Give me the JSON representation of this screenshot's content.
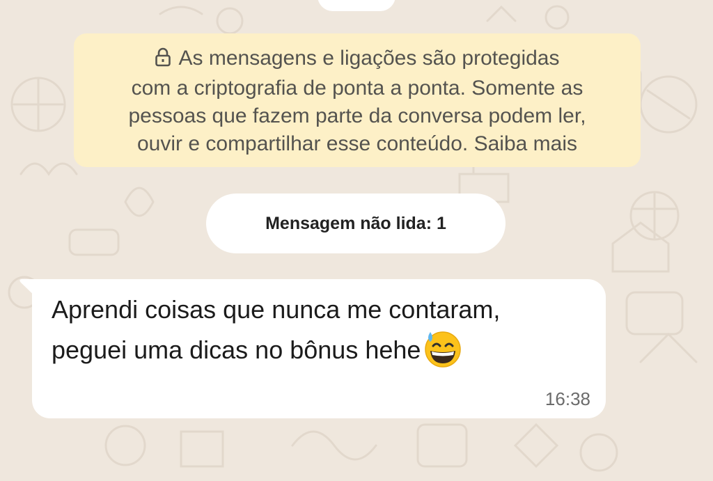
{
  "chat": {
    "encryption_notice": {
      "lock_icon": "lock-icon",
      "line1": "As mensagens e ligações são protegidas",
      "line2": "com a criptografia de ponta a ponta. Somente as",
      "line3": "pessoas que fazem parte da conversa podem ler,",
      "line4": "ouvir e compartilhar esse conteúdo. Saiba mais"
    },
    "unread_divider": "Mensagem não lida: 1",
    "message": {
      "line1": "Aprendi coisas que nunca me contaram,",
      "line2": "peguei uma dicas no bônus hehe",
      "emoji_icon": "grinning-face-with-sweat-emoji",
      "time": "16:38"
    }
  },
  "colors": {
    "wallpaper": "#efe7dd",
    "notice_background": "#fdf0c7",
    "bubble_background": "#ffffff"
  }
}
